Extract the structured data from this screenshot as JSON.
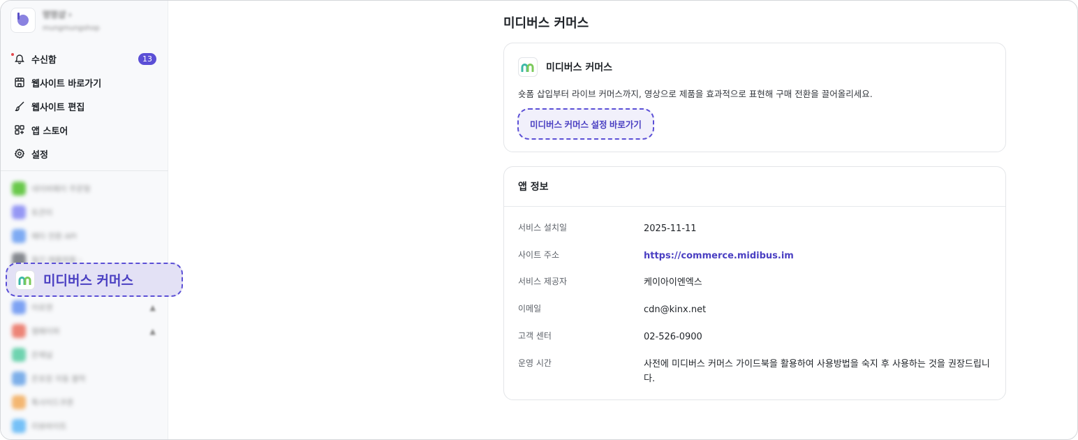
{
  "sidebar": {
    "store": {
      "name": "멍멍샵 ›",
      "id": "mungmungshop"
    },
    "menu": [
      {
        "label": "수신함",
        "badge": "13"
      },
      {
        "label": "웹사이트 바로가기"
      },
      {
        "label": "웹사이트 편집"
      },
      {
        "label": "앱 스토어"
      },
      {
        "label": "설정"
      }
    ],
    "apps_above": [
      {
        "label": "네이버페이 주문형",
        "color": "#2db400"
      },
      {
        "label": "토큰미",
        "color": "#6c6ff2"
      },
      {
        "label": "메타 전환 API",
        "color": "#4b8af0"
      },
      {
        "label": "월간 매출현황 ›",
        "color": "#555a62"
      }
    ],
    "highlighted_app": {
      "label": "미디버스 커머스"
    },
    "apps_below": [
      {
        "label": "아로앤",
        "color": "#4a7ef0",
        "warn": "▲"
      },
      {
        "label": "잼페이퍼",
        "color": "#e8533f",
        "warn": "▲"
      },
      {
        "label": "은채널",
        "color": "#34c38f"
      },
      {
        "label": "은포장 자동 블락",
        "color": "#4a90e2"
      },
      {
        "label": "톡사이드쿠폰",
        "color": "#f29b38"
      },
      {
        "label": "리뷰바이트",
        "color": "#3fa9f5"
      }
    ]
  },
  "main": {
    "title": "미디버스 커머스",
    "app_card": {
      "name": "미디버스 커머스",
      "description": "숏폼 삽입부터 라이브 커머스까지, 영상으로 제품을 효과적으로 표현해 구매 전환을 끌어올리세요.",
      "cta_label": "미디버스 커머스 설정 바로가기"
    },
    "info_card": {
      "title": "앱 정보",
      "rows": [
        {
          "label": "서비스 설치일",
          "value": "2025-11-11"
        },
        {
          "label": "사이트 주소",
          "value": "https://commerce.midibus.im",
          "link": true
        },
        {
          "label": "서비스 제공자",
          "value": "케이아이엔엑스"
        },
        {
          "label": "이메일",
          "value": "cdn@kinx.net"
        },
        {
          "label": "고객 센터",
          "value": "02-526-0900"
        },
        {
          "label": "운영 시간",
          "value": "사전에 미디버스 커머스 가이드북을 활용하여 사용방법을 숙지 후 사용하는 것을 권장드립니다."
        }
      ]
    }
  },
  "colors": {
    "accent": "#5b4fd6",
    "badge": "#5b4fd6",
    "highlight_bg": "#e3e1f5"
  },
  "icons": [
    "bell-icon",
    "store-icon",
    "brush-icon",
    "apps-grid-icon",
    "gear-icon",
    "midibus-logo"
  ]
}
